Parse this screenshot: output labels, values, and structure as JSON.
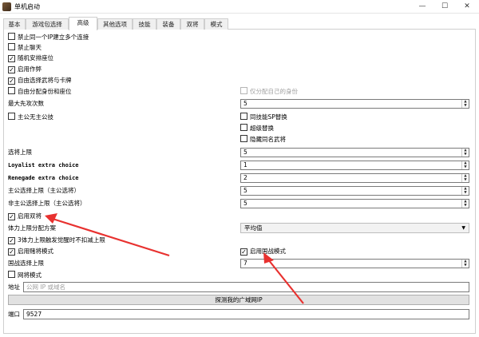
{
  "window": {
    "title": "单机启动",
    "minimize": "—",
    "maximize": "☐",
    "close": "✕"
  },
  "tabs": [
    "基本",
    "游戏包选择",
    "高级",
    "其他选项",
    "技能",
    "装备",
    "双将",
    "模式"
  ],
  "active_tab": 2,
  "options": {
    "forbid_same_ip": "禁止同一个IP建立多个连接",
    "forbid_chat": "禁止聊天",
    "random_seat": "随机安排座位",
    "enable_cheat": "启用作弊",
    "free_choose": "自由选择武将与卡牌",
    "free_assign": "自由分配身份和座位",
    "assign_self_only": "仅分配自己的身份",
    "lord_no_skill": "主公无主公技",
    "replace_sp": "同技能SP替换",
    "super_swap": "超级替换",
    "hide_same_name": "隐藏同名武将",
    "enable_double": "启用双将",
    "hp3_dealer": "3体力上限触发觉醒时不扣减上限",
    "enable_lucky": "启用赌将模式",
    "enable_yang": "启用国战模式",
    "ai_mode": "网将模式"
  },
  "fields": {
    "max_choose_label": "最大先攻次数",
    "max_choose_value": "5",
    "general_limit_label": "选将上限",
    "general_limit_value": "5",
    "loyalist_label": "Loyalist extra choice",
    "loyalist_value": "1",
    "renegade_label": "Renegade extra choice",
    "renegade_value": "2",
    "lord_limit_label": "主公选择上限（主公选将）",
    "lord_limit_value": "5",
    "noble_limit_label": "非主公选择上限（主公选将）",
    "noble_limit_value": "5",
    "hp_scheme_label": "体力上限分配方案",
    "hp_scheme_value": "平均值",
    "hegemony_limit_label": "国战选择上限",
    "hegemony_limit_value": "7",
    "address_label": "地址",
    "address_placeholder": "公网 IP 或域名",
    "detect_button": "探测我的广域网IP",
    "port_label": "端口",
    "port_value": "9527"
  },
  "icons": {
    "check": "✓",
    "spin_up": "▲",
    "spin_down": "▼",
    "combo_arrow": "▼"
  },
  "colors": {
    "annotation_red": "#e8312f",
    "text_dim": "#a0a0a0"
  }
}
